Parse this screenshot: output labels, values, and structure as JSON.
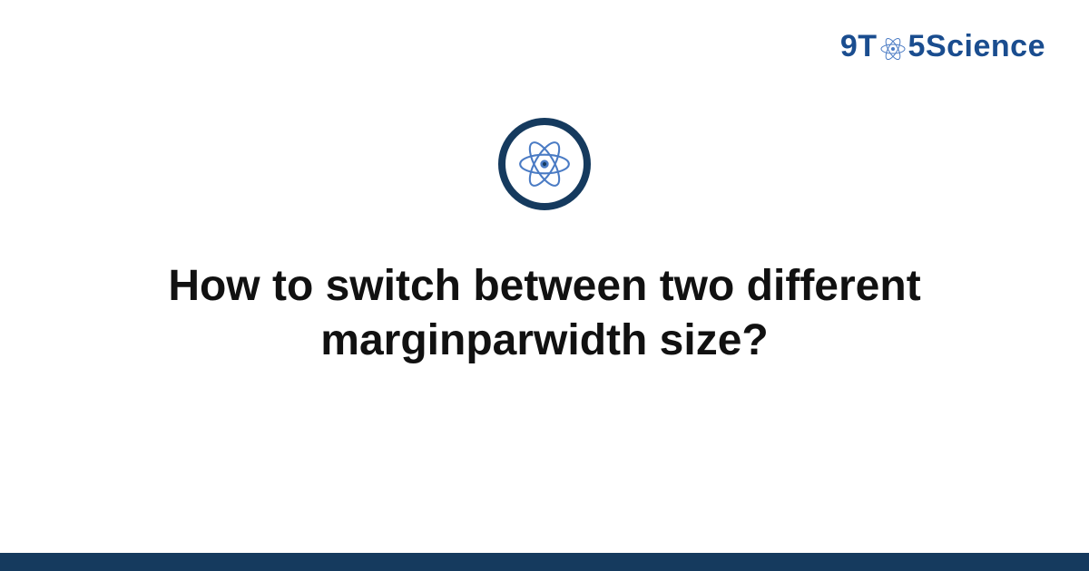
{
  "brand": {
    "prefix": "9T",
    "suffix": "5Science"
  },
  "title": "How to switch between two different marginparwidth size?",
  "colors": {
    "brand_text": "#1a4d8f",
    "dark_navy": "#153a5e",
    "atom_blue": "#4a7bc4"
  }
}
